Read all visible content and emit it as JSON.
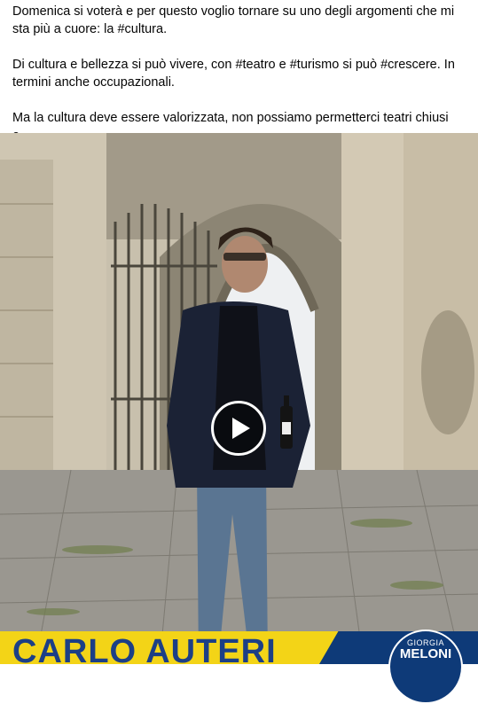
{
  "post": {
    "line1": "Domenica si voterà e per questo voglio tornare su uno degli argomenti che mi sta più a cuore: la #cultura.",
    "line2": "Di cultura e bellezza si può vivere, con #teatro e #turismo si può #crescere. In termini anche occupazionali.",
    "line3": "Ma la cultura deve essere valorizzata, non possiamo permetterci teatri chiusi e…"
  },
  "video": {
    "banner_name": "CARLO AUTERI",
    "logo_top": "GIORGIA",
    "logo_main": "MELONI",
    "play_icon": "play-icon",
    "colors": {
      "banner_yellow": "#f3d417",
      "banner_blue": "#0e3a78",
      "name_text": "#1c3f86"
    }
  }
}
